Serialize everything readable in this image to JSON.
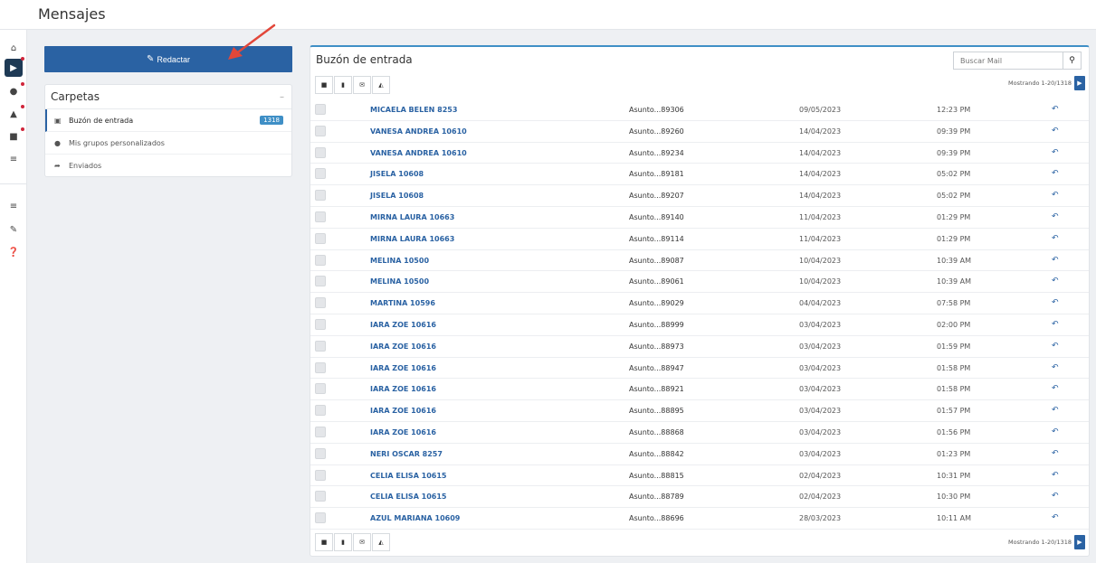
{
  "page": {
    "title": "Mensajes"
  },
  "rail": {
    "icons": [
      "home-icon",
      "bullhorn-icon",
      "users-icon",
      "graduation-cap-icon",
      "money-icon",
      "chart-icon",
      "sliders-icon",
      "wrench-icon",
      "question-icon"
    ]
  },
  "compose": {
    "label": "Redactar"
  },
  "folders": {
    "title": "Carpetas",
    "collapse_glyph": "–",
    "items": [
      {
        "label": "Buzón de entrada",
        "badge": "1318",
        "icon": "inbox-icon"
      },
      {
        "label": "Mis grupos personalizados",
        "icon": "users-icon"
      },
      {
        "label": "Enviados",
        "icon": "share-icon"
      }
    ]
  },
  "inbox": {
    "title": "Buzón de entrada",
    "search_placeholder": "Buscar Mail",
    "paging_text": "Mostrando 1-20/1318",
    "accent_color": "#2a62a3",
    "messages": [
      {
        "name": "MICAELA BELEN 8253",
        "subject": "Asunto...89306",
        "date": "09/05/2023",
        "time": "12:23 PM"
      },
      {
        "name": "VANESA ANDREA 10610",
        "subject": "Asunto...89260",
        "date": "14/04/2023",
        "time": "09:39 PM"
      },
      {
        "name": "VANESA ANDREA 10610",
        "subject": "Asunto...89234",
        "date": "14/04/2023",
        "time": "09:39 PM"
      },
      {
        "name": "JISELA 10608",
        "subject": "Asunto...89181",
        "date": "14/04/2023",
        "time": "05:02 PM"
      },
      {
        "name": "JISELA 10608",
        "subject": "Asunto...89207",
        "date": "14/04/2023",
        "time": "05:02 PM"
      },
      {
        "name": "MIRNA LAURA 10663",
        "subject": "Asunto...89140",
        "date": "11/04/2023",
        "time": "01:29 PM"
      },
      {
        "name": "MIRNA LAURA 10663",
        "subject": "Asunto...89114",
        "date": "11/04/2023",
        "time": "01:29 PM"
      },
      {
        "name": "MELINA 10500",
        "subject": "Asunto...89087",
        "date": "10/04/2023",
        "time": "10:39 AM"
      },
      {
        "name": "MELINA 10500",
        "subject": "Asunto...89061",
        "date": "10/04/2023",
        "time": "10:39 AM"
      },
      {
        "name": "MARTINA 10596",
        "subject": "Asunto...89029",
        "date": "04/04/2023",
        "time": "07:58 PM"
      },
      {
        "name": "IARA ZOE 10616",
        "subject": "Asunto...88999",
        "date": "03/04/2023",
        "time": "02:00 PM"
      },
      {
        "name": "IARA ZOE 10616",
        "subject": "Asunto...88973",
        "date": "03/04/2023",
        "time": "01:59 PM"
      },
      {
        "name": "IARA ZOE 10616",
        "subject": "Asunto...88947",
        "date": "03/04/2023",
        "time": "01:58 PM"
      },
      {
        "name": "IARA ZOE 10616",
        "subject": "Asunto...88921",
        "date": "03/04/2023",
        "time": "01:58 PM"
      },
      {
        "name": "IARA ZOE 10616",
        "subject": "Asunto...88895",
        "date": "03/04/2023",
        "time": "01:57 PM"
      },
      {
        "name": "IARA ZOE 10616",
        "subject": "Asunto...88868",
        "date": "03/04/2023",
        "time": "01:56 PM"
      },
      {
        "name": "NERI OSCAR 8257",
        "subject": "Asunto...88842",
        "date": "03/04/2023",
        "time": "01:23 PM"
      },
      {
        "name": "CELIA ELISA 10615",
        "subject": "Asunto...88815",
        "date": "02/04/2023",
        "time": "10:31 PM"
      },
      {
        "name": "CELIA ELISA 10615",
        "subject": "Asunto...88789",
        "date": "02/04/2023",
        "time": "10:30 PM"
      },
      {
        "name": "AZUL MARIANA 10609",
        "subject": "Asunto...88696",
        "date": "28/03/2023",
        "time": "10:11 AM"
      }
    ]
  }
}
